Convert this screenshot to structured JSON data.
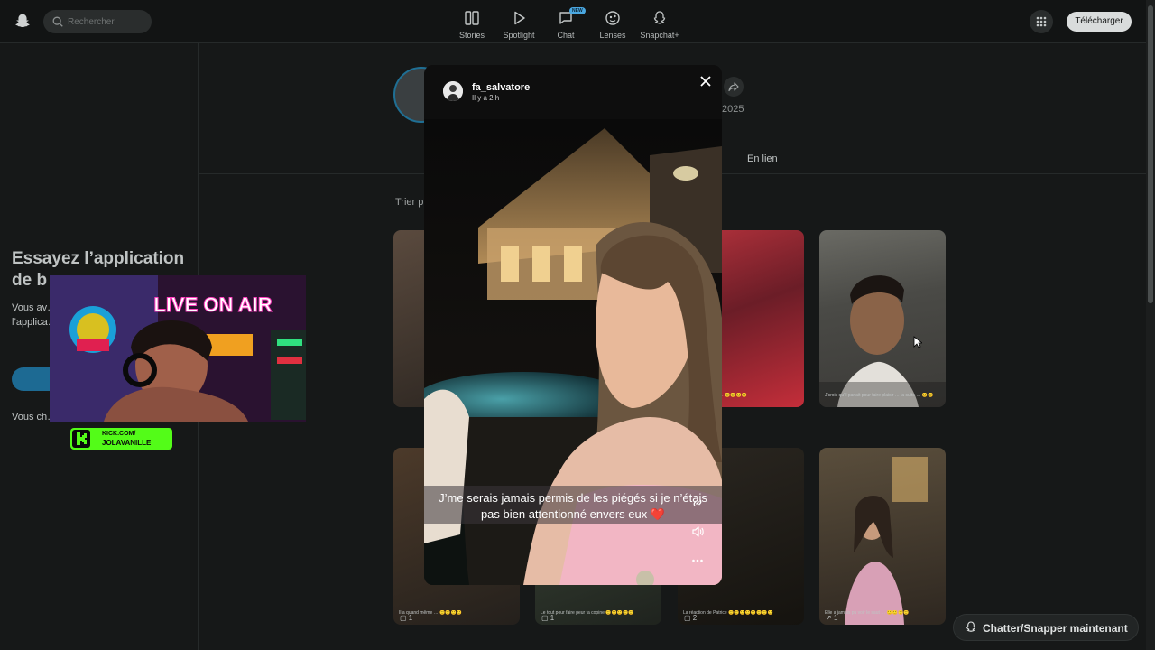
{
  "search": {
    "placeholder": "Rechercher"
  },
  "nav": [
    {
      "label": "Stories"
    },
    {
      "label": "Spotlight"
    },
    {
      "label": "Chat",
      "badge": "NEW"
    },
    {
      "label": "Lenses"
    },
    {
      "label": "Snapchat+"
    }
  ],
  "header": {
    "download_label": "Télécharger"
  },
  "sidebar": {
    "promo_title": "Essayez l’application de b",
    "promo_text": "Vous av… ouverts… facileme… l’applica…",
    "promo_text2": "Vous ch… mobile&nbsp…"
  },
  "profile": {
    "year": "2025",
    "tab_link": "En lien",
    "sort_label": "Trier p"
  },
  "viewer": {
    "username": "fa_salvatore",
    "time": "Il y a 2 h",
    "caption_line1": "J’me serais jamais permis de les piégés si je n’étais",
    "caption_line2": "pas bien attentionné envers eux ❤️"
  },
  "cards": [
    {
      "caption": "",
      "meta": ""
    },
    {
      "caption": "J’veux vs tu peux … 🙂🙂🙂🙂",
      "meta": ""
    },
    {
      "caption": "J’crois qu’il parlait pour faire plaisir … la suite … 🙂🙂",
      "meta": ""
    },
    {
      "caption": "Il a quand même … 🙂🙂🙂🙂",
      "meta": "1"
    },
    {
      "caption": "Le tout pour faire peur ta copine 🙂🙂🙂🙂🙂",
      "meta": "1"
    },
    {
      "caption": "La réaction de Patrice 🙂🙂🙂🙂🙂🙂🙂🙂",
      "meta": "2"
    },
    {
      "caption": "Elle a jamais pu voir le saut … 🙂🙂🙂🙂",
      "meta": "1"
    }
  ],
  "stream": {
    "kick_line1": "KICK.COM/",
    "kick_line2": "JOLAVANILLE",
    "neon": "LIVE ON AIR"
  },
  "chat_cta": {
    "label": "Chatter/Snapper maintenant"
  },
  "colors": {
    "accent": "#1d6a93",
    "kick": "#53fc18",
    "badge": "#4aa7e0"
  }
}
